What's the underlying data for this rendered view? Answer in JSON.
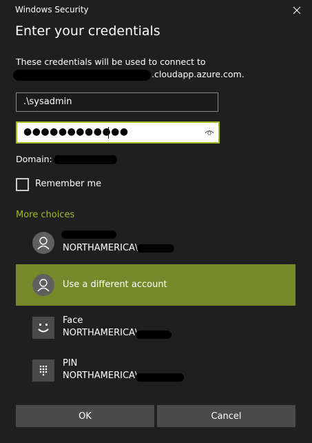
{
  "window": {
    "app_title": "Windows Security",
    "heading": "Enter your credentials"
  },
  "info": {
    "line1": "These credentials will be used to connect to",
    "line2_suffix": ".cloudapp.azure.com."
  },
  "form": {
    "username_value": ".\\sysadmin",
    "password_mask": "●●●●●●●●●●●●",
    "domain_label": "Domain:",
    "remember_label": "Remember me",
    "remember_checked": false
  },
  "more_choices": {
    "label": "More choices",
    "accounts": [
      {
        "line1": "",
        "line2": "NORTHAMERICA\\",
        "icon": "person-icon"
      },
      {
        "line1": "Use a different account",
        "line2": "",
        "icon": "person-icon",
        "selected": true
      },
      {
        "line1": "Face",
        "line2": "NORTHAMERICA\\",
        "icon": "face-icon"
      },
      {
        "line1": "PIN",
        "line2": "NORTHAMERICA\\",
        "icon": "pin-keypad-icon"
      }
    ]
  },
  "buttons": {
    "ok": "OK",
    "cancel": "Cancel"
  },
  "colors": {
    "accent": "#a5bc24",
    "link": "#9fbe2a",
    "selected_row": "#76892a",
    "background": "#1f1f1f",
    "button": "#4a4a4a"
  }
}
